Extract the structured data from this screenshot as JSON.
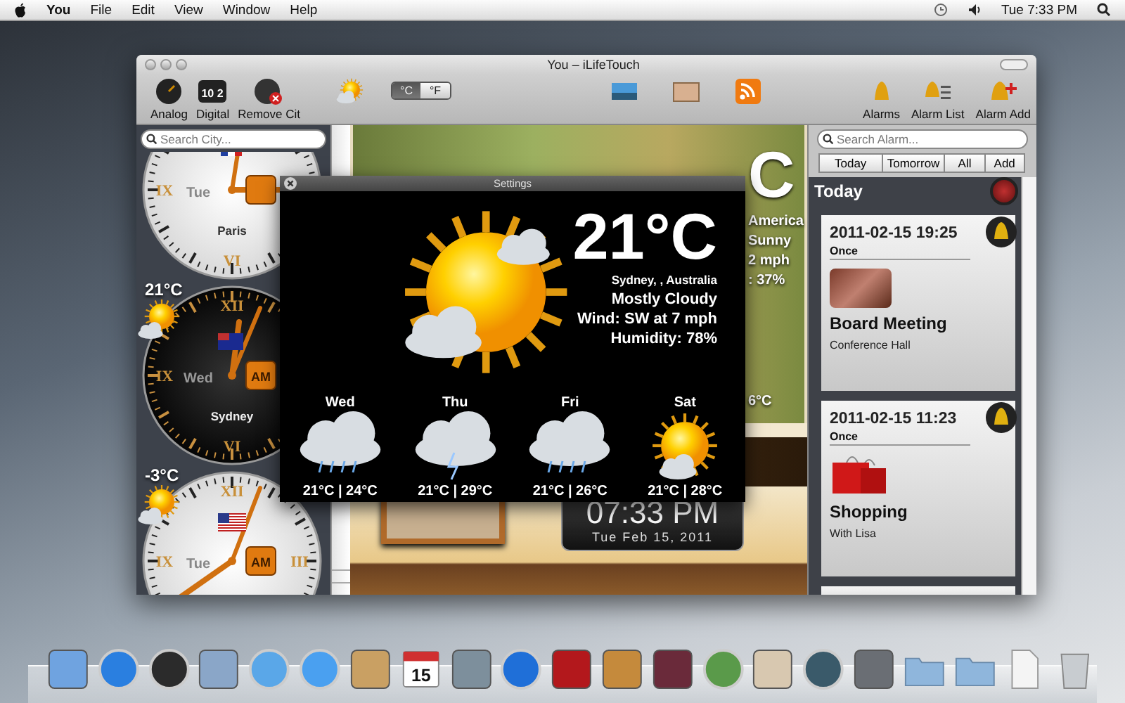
{
  "menu_bar": {
    "app": "You",
    "items": [
      "File",
      "Edit",
      "View",
      "Window",
      "Help"
    ],
    "clock": "Tue 7:33 PM"
  },
  "window": {
    "title": "You – iLifeTouch"
  },
  "toolbar": {
    "left": [
      {
        "kind": "analog",
        "label": "Analog"
      },
      {
        "kind": "digital",
        "label": "Digital",
        "icon_text": "10 2"
      },
      {
        "kind": "remove",
        "label": "Remove Cit"
      }
    ],
    "units": [
      {
        "label": "°C",
        "selected": true
      },
      {
        "label": "°F",
        "selected": false
      }
    ],
    "right": [
      {
        "kind": "bell",
        "label": "Alarms"
      },
      {
        "kind": "list",
        "label": "Alarm List"
      },
      {
        "kind": "add",
        "label": "Alarm Add"
      }
    ]
  },
  "city_panel": {
    "search": {
      "placeholder": "Search City..."
    },
    "clocks": [
      {
        "kind": "light",
        "city": "Paris",
        "day": "Tue",
        "numerals": {
          "left": "IX",
          "bottom": "VI"
        }
      },
      {
        "kind": "dark",
        "city": "Sydney",
        "day": "Wed",
        "am": "AM",
        "temp": "21°C",
        "numerals": {
          "top": "XII",
          "left": "IX",
          "bottom": "VI"
        }
      },
      {
        "kind": "light",
        "day": "Tue",
        "am": "AM",
        "temp": "-3°C",
        "numerals": {
          "top": "XII",
          "left": "IX",
          "right": "III"
        }
      }
    ]
  },
  "scenery": {
    "fragments": [
      "C",
      "America",
      "Sunny",
      "2 mph",
      ": 37%"
    ],
    "bottom_fragment": "6°C",
    "time": "07:33 PM",
    "date": "Tue Feb 15, 2011"
  },
  "settings_popup": {
    "title": "Settings",
    "temp": "21°C",
    "location": "Sydney, , Australia",
    "condition": "Mostly Cloudy",
    "wind": "Wind: SW at 7 mph",
    "humidity": "Humidity: 78%",
    "forecast": [
      {
        "day": "Wed",
        "kind": "rain",
        "temps": "21°C | 24°C"
      },
      {
        "day": "Thu",
        "kind": "storm",
        "temps": "21°C | 29°C"
      },
      {
        "day": "Fri",
        "kind": "rain",
        "temps": "21°C | 26°C"
      },
      {
        "day": "Sat",
        "kind": "sun",
        "temps": "21°C | 28°C"
      }
    ]
  },
  "alarm_panel": {
    "search": {
      "placeholder": "Search Alarm..."
    },
    "filters": [
      "Today",
      "Tomorrow",
      "All",
      "Add"
    ],
    "heading": "Today",
    "alarms": [
      {
        "when": "2011-02-15 19:25",
        "repeat": "Once",
        "kind": "photo",
        "title": "Board Meeting",
        "note": "Conference Hall"
      },
      {
        "when": "2011-02-15 11:23",
        "repeat": "Once",
        "kind": "bag",
        "title": "Shopping",
        "note": "With Lisa"
      }
    ]
  },
  "dock": [
    {
      "kind": "tile",
      "color": "#6fa3e0"
    },
    {
      "kind": "circle",
      "color": "#2a7fe0"
    },
    {
      "kind": "circle",
      "color": "#2b2b2b"
    },
    {
      "kind": "tile",
      "color": "#8aa6c8"
    },
    {
      "kind": "circle",
      "color": "#5aa7e8"
    },
    {
      "kind": "circle",
      "color": "#4aa0f0"
    },
    {
      "kind": "tile",
      "color": "#c9a063"
    },
    {
      "kind": "calendar",
      "color": "#ffffff",
      "label": "15"
    },
    {
      "kind": "tile",
      "color": "#7d8f9c"
    },
    {
      "kind": "circle",
      "color": "#1f6fd8"
    },
    {
      "kind": "tile",
      "color": "#b3181c"
    },
    {
      "kind": "tile",
      "color": "#c58a3c"
    },
    {
      "kind": "tile",
      "color": "#6a2a3a"
    },
    {
      "kind": "circle",
      "color": "#5a9a4a"
    },
    {
      "kind": "tile",
      "color": "#d8c8b0"
    },
    {
      "kind": "circle",
      "color": "#3a5a6a"
    },
    {
      "kind": "tile",
      "color": "#6a6e74"
    },
    {
      "kind": "folder",
      "color": "#8fb6dc"
    },
    {
      "kind": "folder",
      "color": "#8fb6dc"
    },
    {
      "kind": "doc",
      "color": "#f4f4f4"
    },
    {
      "kind": "trash",
      "color": "#c8ccd0"
    }
  ]
}
